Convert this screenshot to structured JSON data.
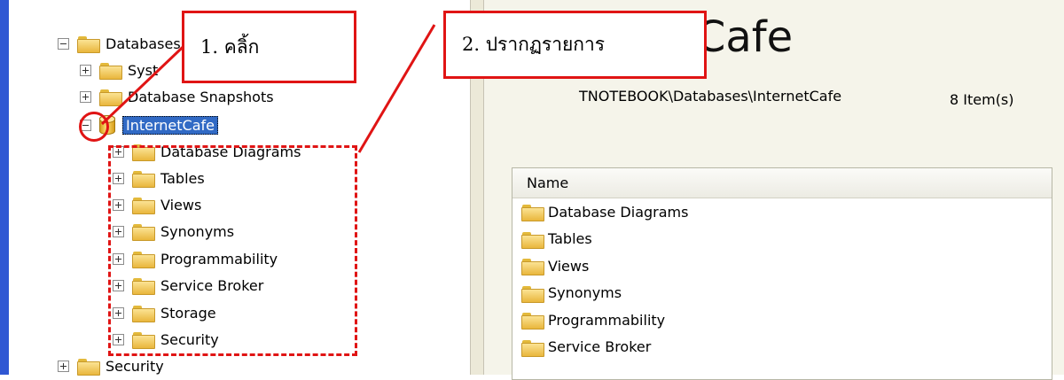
{
  "tree": {
    "items": [
      {
        "label": "Databases",
        "expander": "minus"
      },
      {
        "label": "Syst",
        "expander": "plus"
      },
      {
        "label": "Database Snapshots",
        "expander": "plus"
      },
      {
        "label": "InternetCafe",
        "expander": "minus",
        "selected": true
      },
      {
        "label": "Database Diagrams",
        "expander": "plus"
      },
      {
        "label": "Tables",
        "expander": "plus"
      },
      {
        "label": "Views",
        "expander": "plus"
      },
      {
        "label": "Synonyms",
        "expander": "plus"
      },
      {
        "label": "Programmability",
        "expander": "plus"
      },
      {
        "label": "Service Broker",
        "expander": "plus"
      },
      {
        "label": "Storage",
        "expander": "plus"
      },
      {
        "label": "Security",
        "expander": "plus"
      },
      {
        "label": "Security",
        "expander": "plus"
      }
    ]
  },
  "annotations": {
    "step1": "1. คลิ้ก",
    "step2": "2. ปรากฏรายการ"
  },
  "summary": {
    "title": "tCafe",
    "path": "TNOTEBOOK\\Databases\\InternetCafe",
    "count": "8 Item(s)"
  },
  "list": {
    "header": "Name",
    "rows": [
      "Database Diagrams",
      "Tables",
      "Views",
      "Synonyms",
      "Programmability",
      "Service Broker"
    ]
  },
  "colors": {
    "annotation_red": "#e01414",
    "selection_blue": "#316ac5",
    "folder_yellow": "#f3cf5b",
    "scroll_blue": "#2f57d3"
  }
}
